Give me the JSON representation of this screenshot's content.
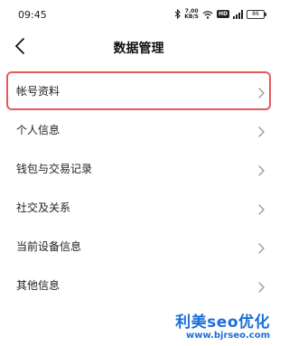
{
  "status_bar": {
    "time": "09:45",
    "speed_value": "7.00",
    "speed_unit": "KB/S",
    "network_badge": "HD",
    "battery": "86"
  },
  "header": {
    "title": "数据管理"
  },
  "list": {
    "items": [
      {
        "label": "帐号资料",
        "highlighted": true
      },
      {
        "label": "个人信息"
      },
      {
        "label": "钱包与交易记录"
      },
      {
        "label": "社交及关系"
      },
      {
        "label": "当前设备信息"
      },
      {
        "label": "其他信息"
      }
    ]
  },
  "watermark": {
    "brand": "利美seo优化",
    "url": "www.bjrseo.com"
  },
  "colors": {
    "highlight_border": "#e9575b",
    "watermark": "#1c6fd6"
  }
}
